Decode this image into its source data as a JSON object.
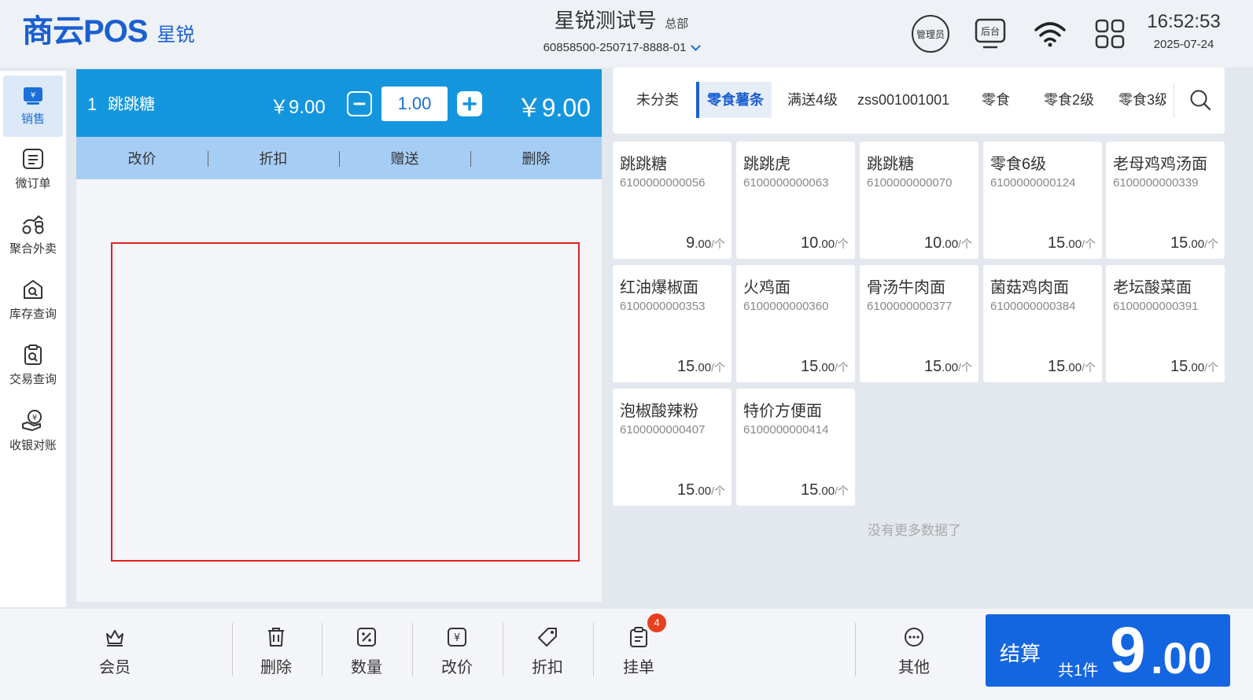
{
  "header": {
    "logo": "商云POS",
    "brand_sub": "星锐",
    "store_name": "星锐测试号",
    "store_tag": "总部",
    "terminal_id": "60858500-250717-8888-01",
    "admin_label": "管理员",
    "backend_label": "后台",
    "time": "16:52:53",
    "date": "2025-07-24"
  },
  "nav": {
    "items": [
      {
        "label": "销售",
        "icon": "sales-icon"
      },
      {
        "label": "微订单",
        "icon": "micro-order-icon"
      },
      {
        "label": "聚合外卖",
        "icon": "delivery-icon"
      },
      {
        "label": "库存查询",
        "icon": "inventory-search-icon"
      },
      {
        "label": "交易查询",
        "icon": "transaction-search-icon"
      },
      {
        "label": "收银对账",
        "icon": "reconcile-icon"
      }
    ]
  },
  "cart": {
    "items": [
      {
        "index": "1",
        "name": "跳跳糖",
        "price": "￥9.00",
        "qty": "1.00",
        "total": "￥9.00"
      }
    ],
    "actions": [
      "改价",
      "折扣",
      "赠送",
      "删除"
    ]
  },
  "categories": [
    "未分类",
    "零食薯条",
    "满送4级",
    "zss001001001",
    "零食",
    "零食2级",
    "零食3级"
  ],
  "products": [
    {
      "name": "跳跳糖",
      "code": "6100000000056",
      "price_int": "9",
      "price_dec": ".00",
      "unit": "/个"
    },
    {
      "name": "跳跳虎",
      "code": "6100000000063",
      "price_int": "10",
      "price_dec": ".00",
      "unit": "/个"
    },
    {
      "name": "跳跳糖",
      "code": "6100000000070",
      "price_int": "10",
      "price_dec": ".00",
      "unit": "/个"
    },
    {
      "name": "零食6级",
      "code": "6100000000124",
      "price_int": "15",
      "price_dec": ".00",
      "unit": "/个"
    },
    {
      "name": "老母鸡鸡汤面",
      "code": "6100000000339",
      "price_int": "15",
      "price_dec": ".00",
      "unit": "/个"
    },
    {
      "name": "红油爆椒面",
      "code": "6100000000353",
      "price_int": "15",
      "price_dec": ".00",
      "unit": "/个"
    },
    {
      "name": "火鸡面",
      "code": "6100000000360",
      "price_int": "15",
      "price_dec": ".00",
      "unit": "/个"
    },
    {
      "name": "骨汤牛肉面",
      "code": "6100000000377",
      "price_int": "15",
      "price_dec": ".00",
      "unit": "/个"
    },
    {
      "name": "菌菇鸡肉面",
      "code": "6100000000384",
      "price_int": "15",
      "price_dec": ".00",
      "unit": "/个"
    },
    {
      "name": "老坛酸菜面",
      "code": "6100000000391",
      "price_int": "15",
      "price_dec": ".00",
      "unit": "/个"
    },
    {
      "name": "泡椒酸辣粉",
      "code": "6100000000407",
      "price_int": "15",
      "price_dec": ".00",
      "unit": "/个"
    },
    {
      "name": "特价方便面",
      "code": "6100000000414",
      "price_int": "15",
      "price_dec": ".00",
      "unit": "/个"
    }
  ],
  "no_more": "没有更多数据了",
  "toolbar": {
    "member": "会员",
    "delete": "删除",
    "quantity": "数量",
    "change_price": "改价",
    "discount": "折扣",
    "hold": "挂单",
    "hold_count": "4",
    "other": "其他"
  },
  "checkout": {
    "label": "结算",
    "count": "共1件",
    "amount_int": "9",
    "amount_dec": ".00"
  },
  "colors": {
    "primary": "#1466e0",
    "cart_row": "#1496de",
    "cart_actions": "#a6cdf4",
    "badge": "#e8401f"
  }
}
